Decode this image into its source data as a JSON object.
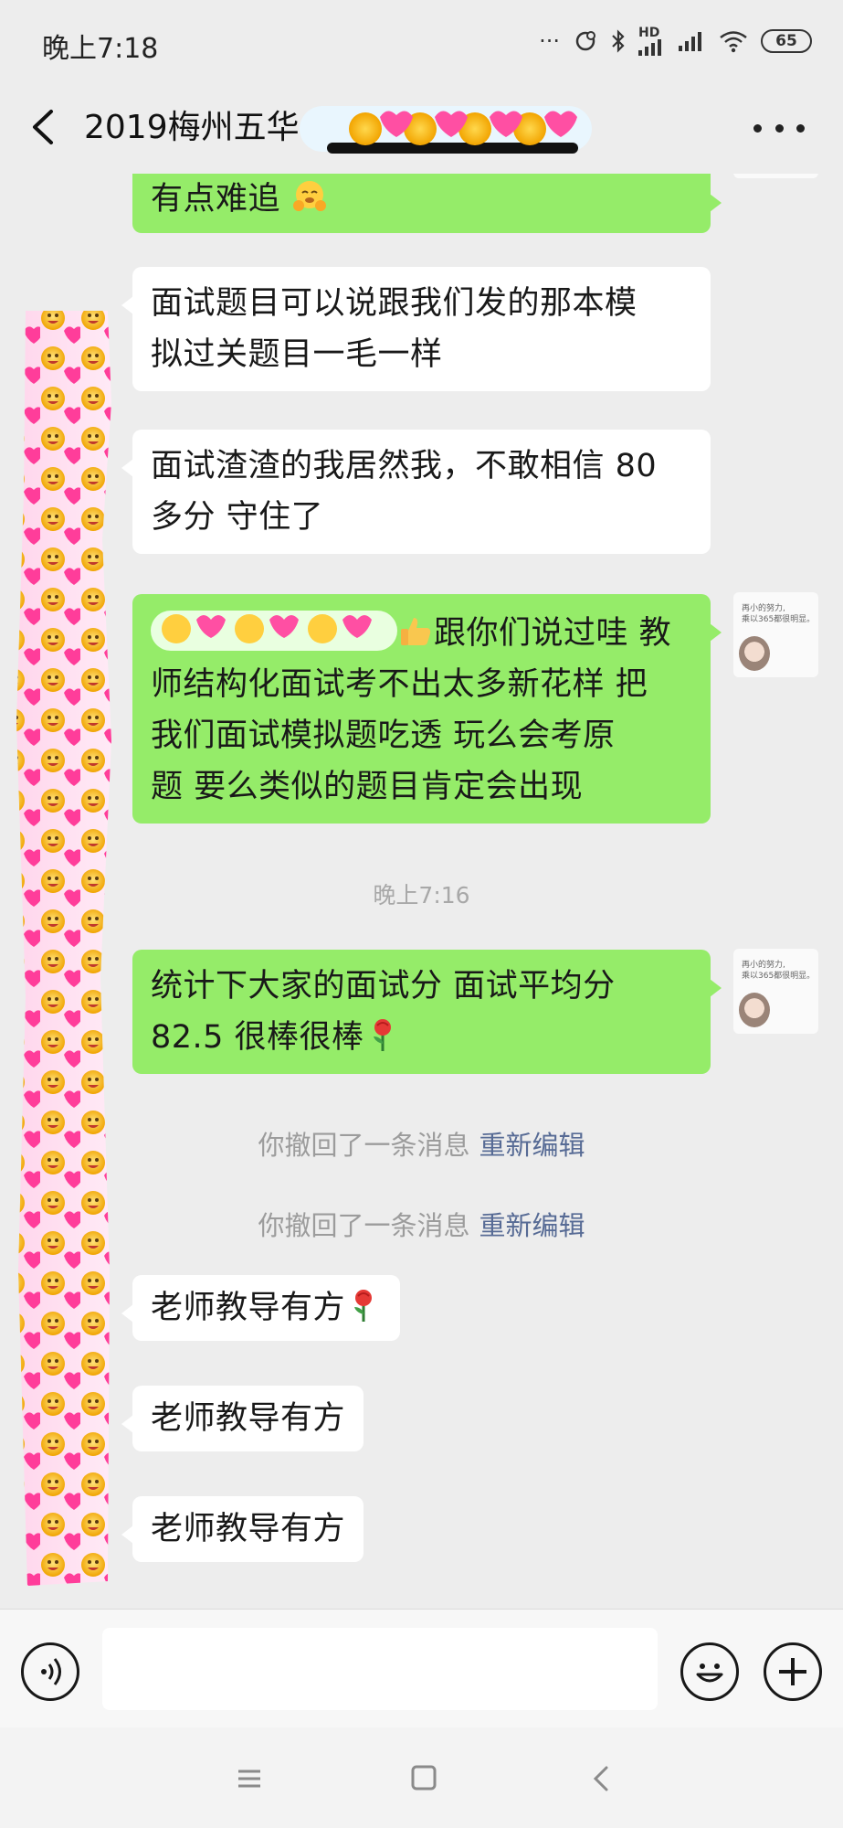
{
  "status_bar": {
    "time": "晚上7:18",
    "network_label": "HD",
    "battery": "65",
    "icons": [
      "more-dots-icon",
      "location-icon",
      "bluetooth-icon",
      "signal-icon",
      "signal-icon",
      "wifi-icon",
      "battery-icon"
    ]
  },
  "header": {
    "title": "2019梅州五华",
    "back_icon": "chevron-left-icon",
    "more_icon": "more-horizontal-icon"
  },
  "messages": [
    {
      "side": "out",
      "text": "有点难追",
      "emoji": "hugging-face-emoji"
    },
    {
      "side": "in",
      "lines": [
        "面试题目可以说跟我们发的那本模",
        "拟过关题目一毛一样"
      ]
    },
    {
      "side": "in",
      "lines": [
        "面试渣渣的我居然我，不敢相信 80",
        "多分  守住了"
      ]
    },
    {
      "side": "out",
      "lines": [
        "跟你们说过哇  教",
        "师结构化面试考不出太多新花样  把",
        "我们面试模拟题吃透  玩么会考原",
        "题  要么类似的题目肯定会出现"
      ],
      "emoji": "thumbs-up-emoji"
    },
    {
      "side": "out",
      "lines": [
        "统计下大家的面试分     面试平均分",
        "82.5    很棒很棒"
      ],
      "emoji": "rose-emoji"
    },
    {
      "side": "in",
      "text": "老师教导有方",
      "emoji": "rose-emoji"
    },
    {
      "side": "in",
      "text": "老师教导有方"
    },
    {
      "side": "in",
      "text": "老师教导有方"
    }
  ],
  "timestamp": "晚上7:16",
  "recalls": [
    {
      "text": "你撤回了一条消息",
      "action": "重新编辑"
    },
    {
      "text": "你撤回了一条消息",
      "action": "重新编辑"
    }
  ],
  "my_avatar": {
    "line1": "再小的努力,",
    "line2": "乘以365都很明显。"
  },
  "composer": {
    "placeholder": "",
    "icons": [
      "voice-icon",
      "emoji-icon",
      "plus-icon"
    ]
  },
  "system_nav": {
    "icons": [
      "menu-icon",
      "home-icon",
      "back-icon"
    ]
  }
}
